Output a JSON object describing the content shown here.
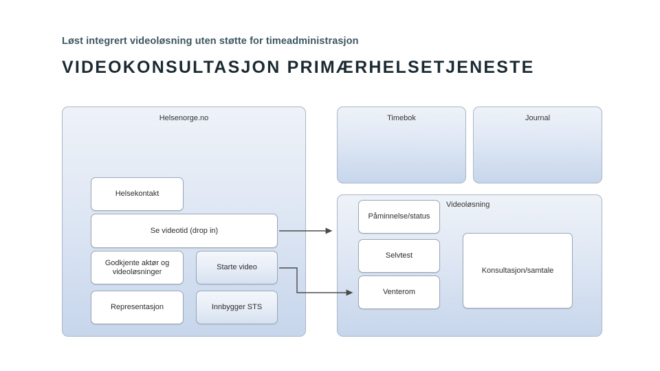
{
  "header": {
    "subtitle": "Løst integrert videoløsning uten støtte for timeadministrasjon",
    "title": "VIDEOKONSULTASJON PRIMÆRHELSETJENESTE"
  },
  "diagram": {
    "type": "block-diagram",
    "groups": [
      {
        "id": "helsenorge",
        "label": "Helsenorge.no"
      },
      {
        "id": "timebok",
        "label": "Timebok"
      },
      {
        "id": "journal",
        "label": "Journal"
      },
      {
        "id": "videolosning",
        "label": "Videoløsning"
      }
    ],
    "nodes": [
      {
        "id": "helsekontakt",
        "label": "Helsekontakt",
        "group": "helsenorge",
        "style": "white"
      },
      {
        "id": "se-videotid",
        "label": "Se videotid (drop in)",
        "group": "helsenorge",
        "style": "white"
      },
      {
        "id": "godkjente-aktor",
        "label": "Godkjente aktør og videoløsninger",
        "group": "helsenorge",
        "style": "white"
      },
      {
        "id": "starte-video",
        "label": "Starte video",
        "group": "helsenorge",
        "style": "blue"
      },
      {
        "id": "representasjon",
        "label": "Representasjon",
        "group": "helsenorge",
        "style": "white"
      },
      {
        "id": "innbygger-sts",
        "label": "Innbygger STS",
        "group": "helsenorge",
        "style": "blue"
      },
      {
        "id": "paminnelse-status",
        "label": "Påminnelse/status",
        "group": "videolosning",
        "style": "white"
      },
      {
        "id": "selvtest",
        "label": "Selvtest",
        "group": "videolosning",
        "style": "white"
      },
      {
        "id": "venterom",
        "label": "Venterom",
        "group": "videolosning",
        "style": "white"
      },
      {
        "id": "konsultasjon-samtale",
        "label": "Konsultasjon/samtale",
        "group": "videolosning",
        "style": "white"
      }
    ],
    "connectors": [
      {
        "from": "se-videotid",
        "to": "videolosning",
        "kind": "arrow"
      },
      {
        "from": "starte-video",
        "to": "venterom",
        "kind": "arrow"
      }
    ],
    "colors": {
      "group_fill_top": "#eef2f8",
      "group_fill_bottom": "#c7d6ec",
      "node_border": "#9aa7b4",
      "title_color": "#1b2a32",
      "subtitle_color": "#3d5560"
    }
  }
}
